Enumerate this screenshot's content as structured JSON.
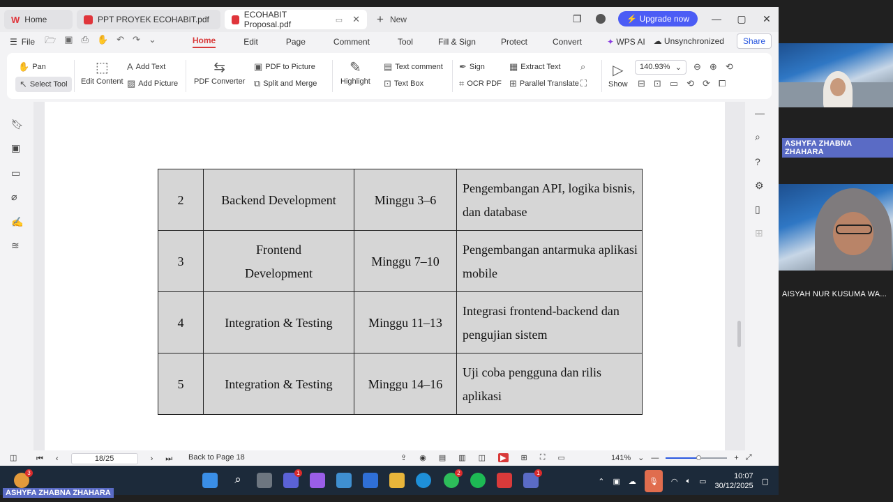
{
  "tabs": [
    {
      "label": "Home",
      "active": false
    },
    {
      "label": "PPT PROYEK ECOHABIT.pdf",
      "active": false
    },
    {
      "label": "ECOHABIT Proposal.pdf",
      "active": true
    }
  ],
  "new_tab_label": "New",
  "upgrade_label": "Upgrade now",
  "menu": {
    "file_label": "File",
    "items": [
      "Home",
      "Edit",
      "Page",
      "Comment",
      "Tool",
      "Fill & Sign",
      "Protect",
      "Convert",
      "WPS AI"
    ],
    "sync_label": "Unsynchronized",
    "share_label": "Share"
  },
  "ribbon": {
    "pan": "Pan",
    "select_tool": "Select Tool",
    "edit_content": "Edit Content",
    "add_text": "Add Text",
    "add_picture": "Add Picture",
    "pdf_converter": "PDF Converter",
    "pdf_to_picture": "PDF to Picture",
    "split_merge": "Split and Merge",
    "highlight": "Highlight",
    "text_comment": "Text comment",
    "text_box": "Text Box",
    "sign": "Sign",
    "ocr_pdf": "OCR PDF",
    "extract_text": "Extract Text",
    "parallel_translate": "Parallel Translate",
    "show": "Show",
    "zoom_value": "140.93%"
  },
  "table_rows": [
    {
      "no": "2",
      "task": "Backend Development",
      "week": "Minggu 3–6",
      "desc": "Pengembangan API, logika bisnis, dan database"
    },
    {
      "no": "3",
      "task": "Frontend Development",
      "week": "Minggu 7–10",
      "desc": "Pengembangan antarmuka aplikasi mobile"
    },
    {
      "no": "4",
      "task": "Integration & Testing",
      "week": "Minggu 11–13",
      "desc": "Integrasi frontend-backend dan pengujian sistem"
    },
    {
      "no": "5",
      "task": "Integration & Testing",
      "week": "Minggu 14–16",
      "desc": "Uji coba pengguna dan rilis aplikasi"
    }
  ],
  "status": {
    "page_indicator": "18/25",
    "back_to_page": "Back to Page 18",
    "zoom_percent": "141%"
  },
  "taskbar": {
    "time": "10:07",
    "date": "30/12/2025",
    "badges": {
      "weather": "3",
      "teams": "1",
      "whatsapp": "2",
      "meet": "1"
    }
  },
  "participants": [
    {
      "name": "ASHYFA ZHABNA ZHAHARA",
      "highlighted": true
    },
    {
      "name": "AISYAH NUR KUSUMA WA...",
      "highlighted": false
    }
  ],
  "presenter_label": "ASHYFA ZHABNA ZHAHARA",
  "colors": {
    "accent": "#d83a3a",
    "upgrade": "#4b5cf5",
    "taskbar": "#1c2a3a",
    "name_tag": "#5a6bc5"
  }
}
